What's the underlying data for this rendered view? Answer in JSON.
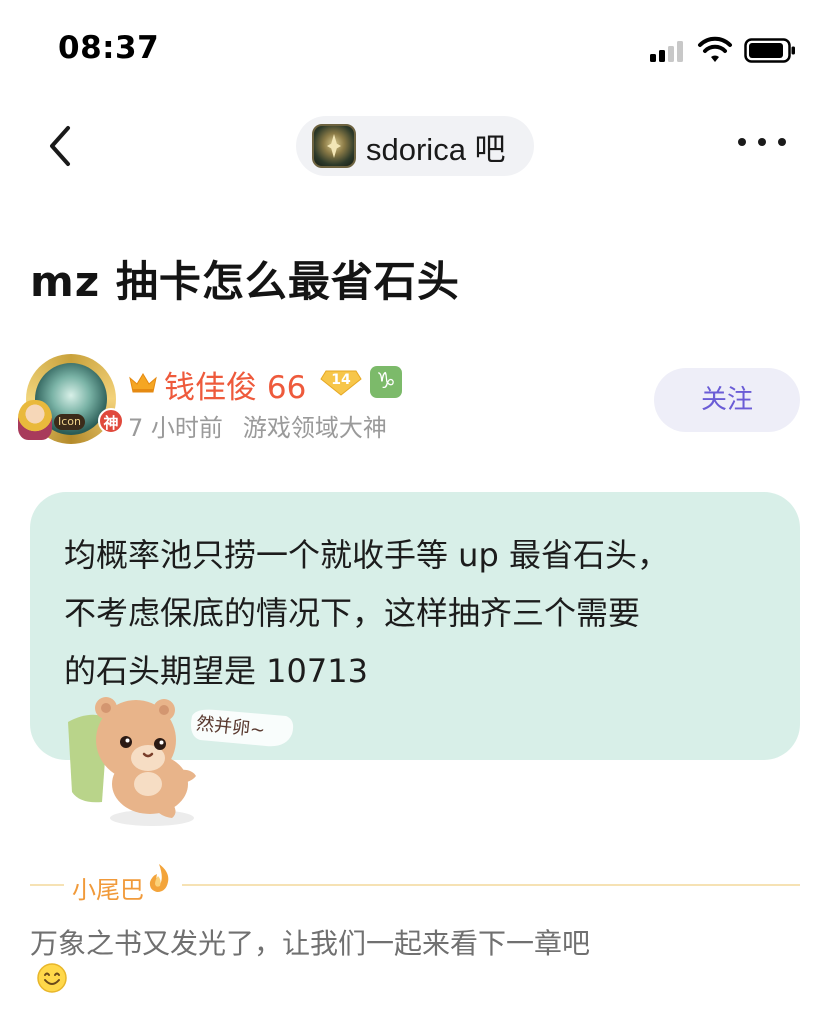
{
  "status_bar": {
    "time": "08:37",
    "icons": [
      "cellular-signal-icon",
      "wifi-icon",
      "battery-icon"
    ]
  },
  "nav": {
    "back_icon": "chevron-left-icon",
    "forum_name": "sdorica 吧",
    "more_icon": "more-dots-icon"
  },
  "post": {
    "title": "mz 抽卡怎么最省石头",
    "author": {
      "name": "钱佳俊 66",
      "level": "14",
      "avatar_tag": "Icon",
      "avatar_badge": "神",
      "zodiac_symbol": "♑",
      "time_ago": "7 小时前",
      "honor": "游戏领域大神"
    },
    "follow_label": "关注",
    "body_lines": [
      "均概率池只捞一个就收手等 up 最省石头，",
      "不考虑保底的情况下，这样抽齐三个需要",
      "的石头期望是 10713"
    ],
    "sticker_text": "然并卵~"
  },
  "signature": {
    "label": "小尾巴",
    "text": "万象之书又发光了，让我们一起来看下一章吧"
  },
  "colors": {
    "username": "#ee5a3c",
    "follow_text": "#6a5cd6",
    "bubble_bg": "#d8efe8",
    "tail_label": "#f19a3a"
  }
}
